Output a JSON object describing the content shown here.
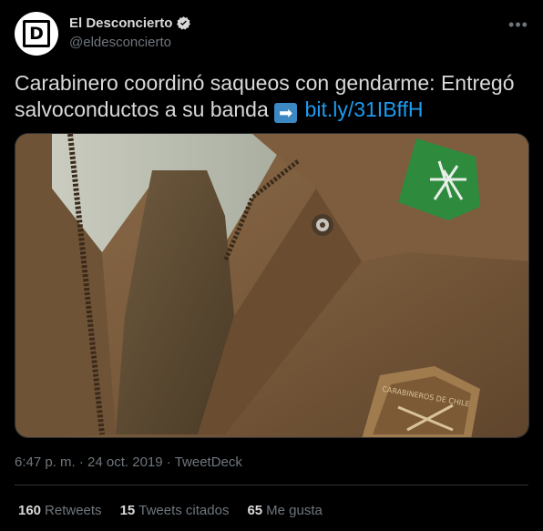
{
  "account": {
    "display_name": "El Desconcierto",
    "handle": "@eldesconcierto",
    "avatar_letter": "D",
    "verified": true
  },
  "menu_icon": "more-horizontal-icon",
  "tweet": {
    "text_line1": "Carabinero coordinó saqueos con gendarme: Entregó",
    "text_line2": "salvoconductos a su banda",
    "emoji": "➡",
    "link": "bit.ly/31IBffH"
  },
  "media": {
    "badge_text": "CARABINEROS DE CHILE"
  },
  "meta": {
    "time": "6:47 p. m.",
    "separator1": " · ",
    "date": "24 oct. 2019",
    "separator2": " · ",
    "source": "TweetDeck"
  },
  "stats": {
    "retweets_count": "160",
    "retweets_label": "Retweets",
    "quotes_count": "15",
    "quotes_label": "Tweets citados",
    "likes_count": "65",
    "likes_label": "Me gusta"
  },
  "colors": {
    "background": "#000000",
    "text": "#d9d9d9",
    "muted": "#6e767d",
    "link": "#1d9bf0",
    "verified": "#d9d9d9"
  }
}
